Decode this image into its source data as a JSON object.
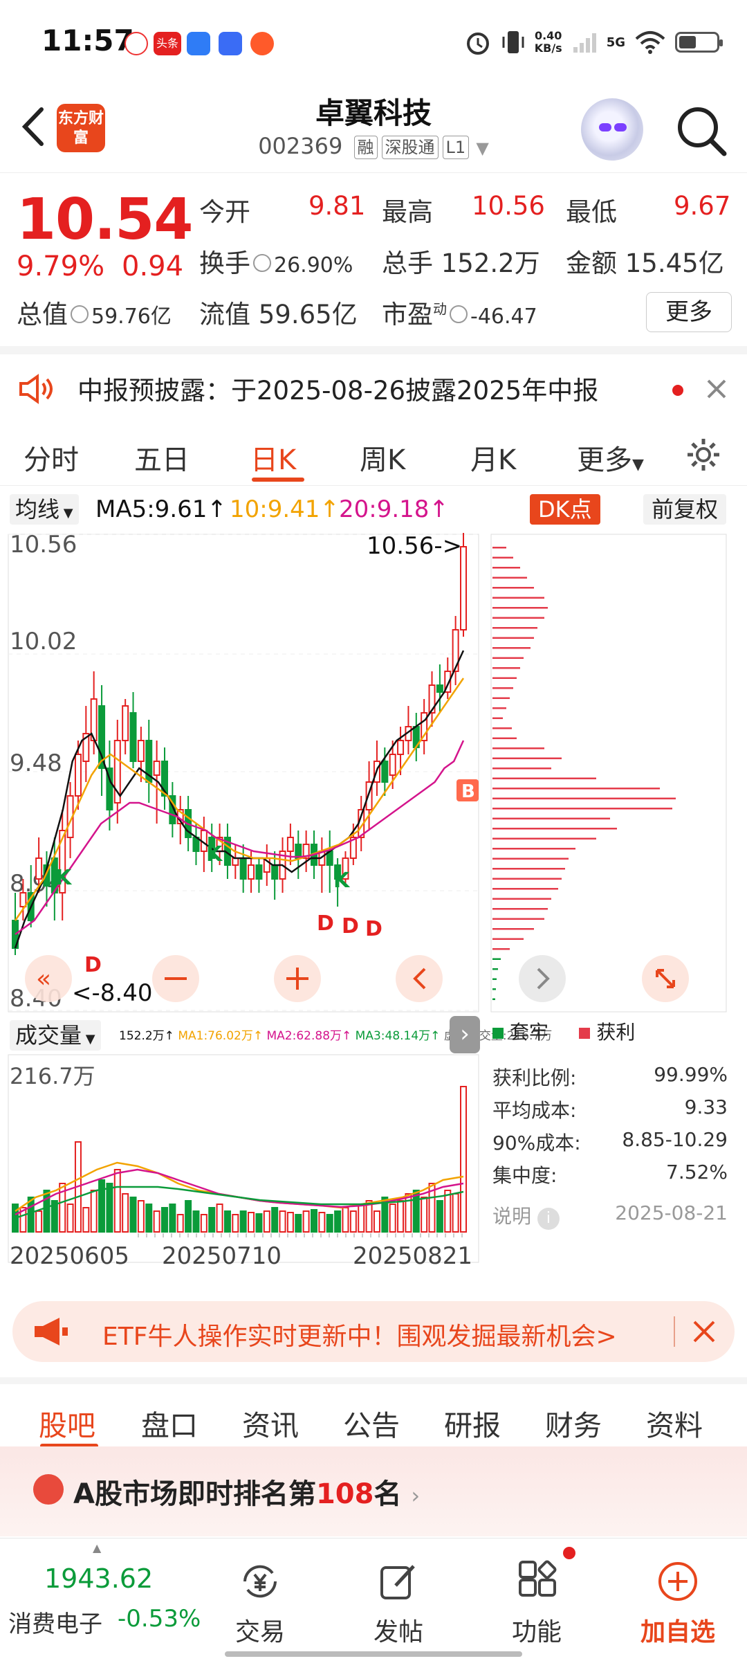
{
  "status_bar": {
    "time": "11:57",
    "net_speed_top": "0.40",
    "net_speed_bottom": "KB/s",
    "network": "5G",
    "app_label": "头条"
  },
  "header": {
    "brand": "东方财富",
    "stock_name": "卓翼科技",
    "code": "002369",
    "tag1": "融",
    "tag2": "深股通",
    "tag3": "L1"
  },
  "quote": {
    "price": "10.54",
    "pct": "9.79%",
    "change": "0.94",
    "open_label": "今开",
    "open": "9.81",
    "high_label": "最高",
    "high": "10.56",
    "low_label": "最低",
    "low": "9.67",
    "turnover_label": "换手",
    "turnover": "26.90%",
    "volume_label": "总手",
    "volume": "152.2万",
    "amount_label": "金额",
    "amount": "15.45亿",
    "mktcap_label": "总值",
    "mktcap": "59.76亿",
    "float_label": "流值",
    "float": "59.65亿",
    "pe_label": "市盈",
    "pe_sup": "动",
    "pe": "-46.47",
    "more": "更多"
  },
  "notice": {
    "text": "中报预披露：于2025-08-26披露2025年中报"
  },
  "chart_tabs": [
    "分时",
    "五日",
    "日K",
    "周K",
    "月K",
    "更多"
  ],
  "ma_row": {
    "select": "均线",
    "ma5": "MA5:9.61↑",
    "ma10": "10:9.41↑",
    "ma20": "20:9.18↑",
    "dk": "DK点",
    "fuquan": "前复权"
  },
  "kline": {
    "y_labels": [
      "10.56",
      "10.02",
      "9.48",
      "8.94",
      "8.40"
    ],
    "max_note": "10.56->",
    "min_note": "<-8.40",
    "signals": [
      "K",
      "D",
      "K",
      "D",
      "K",
      "D",
      "D",
      "B"
    ]
  },
  "volume_header": {
    "select": "成交量",
    "total": "152.2万↑",
    "ma1": "MA1:76.02万↑",
    "ma2": "MA2:62.88万↑",
    "ma3": "MA3:48.14万↑",
    "virtual": "虚拟成交量:216.7万",
    "ymax": "216.7万"
  },
  "x_dates": [
    "20250605",
    "20250710",
    "20250821"
  ],
  "distribution": {
    "legend_trapped": "套牢",
    "legend_profit": "获利",
    "stats": [
      {
        "label": "获利比例:",
        "value": "99.99%"
      },
      {
        "label": "平均成本:",
        "value": "9.33"
      },
      {
        "label": "90%成本:",
        "value": "8.85-10.29"
      },
      {
        "label": "集中度:",
        "value": "7.52%"
      }
    ],
    "note_label": "说明",
    "date": "2025-08-21"
  },
  "etf_banner": {
    "text": "ETF牛人操作实时更新中！围观发掘最新机会>"
  },
  "section_tabs": [
    "股吧",
    "盘口",
    "资讯",
    "公告",
    "研报",
    "财务",
    "资料"
  ],
  "rank_banner": {
    "prefix": "A股市场即时排名第",
    "rank": "108",
    "suffix": "名"
  },
  "bottom_nav": {
    "index_value": "1943.62",
    "index_name": "消费电子",
    "index_change": "-0.53%",
    "trade": "交易",
    "post": "发帖",
    "function": "功能",
    "add_watch": "加自选"
  },
  "colors": {
    "up": "#e42020",
    "down": "#0b9b3a",
    "accent": "#e8461c",
    "ma5": "#111111",
    "ma10": "#f2a300",
    "ma20": "#d4148c"
  }
}
